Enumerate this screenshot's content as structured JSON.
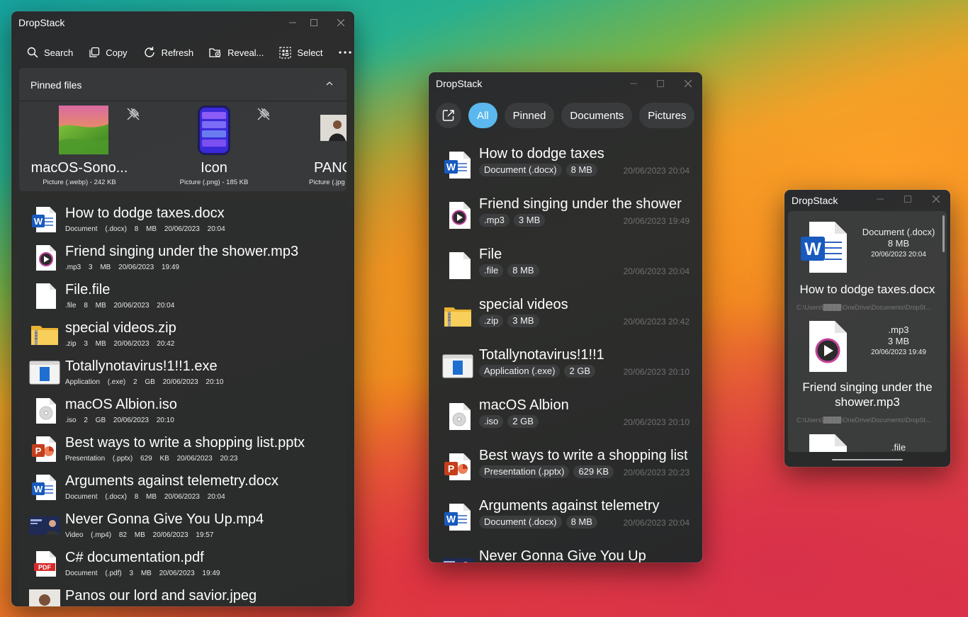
{
  "colors": {
    "accent": "#5bb8ee",
    "window_bg": "#2b2c2d",
    "chip_bg": "#3a3b3c"
  },
  "window_controls": [
    "minimize-icon",
    "maximize-icon",
    "close-icon"
  ],
  "w1": {
    "title": "DropStack",
    "toolbar": [
      {
        "label": "Search",
        "icon": "search-icon"
      },
      {
        "label": "Copy",
        "icon": "copy-icon"
      },
      {
        "label": "Refresh",
        "icon": "refresh-icon"
      },
      {
        "label": "Reveal...",
        "icon": "reveal-folder-icon"
      },
      {
        "label": "Select",
        "icon": "select-icon"
      }
    ],
    "more_icon": "more-icon",
    "pinned": {
      "title": "Pinned files",
      "items": [
        {
          "name": "macOS-Sono...",
          "meta": "Picture (.webp)  -  242   KB",
          "icon": "image-thumbnail"
        },
        {
          "name": "Icon",
          "meta": "Picture (.png)  -  185   KB",
          "icon": "phone-icon"
        },
        {
          "name": "PANO",
          "meta": "Picture (.jpg",
          "icon": "photo-thumbnail"
        }
      ]
    },
    "files": [
      {
        "name": "How to dodge taxes.docx",
        "meta": "Document (.docx) 8 MB 20/06/2023 20:04",
        "icon": "word-icon"
      },
      {
        "name": "Friend singing under the shower.mp3",
        "meta": ".mp3 3 MB 20/06/2023 19:49",
        "icon": "audio-icon"
      },
      {
        "name": "File.file",
        "meta": ".file 8 MB 20/06/2023 20:04",
        "icon": "blank-file-icon"
      },
      {
        "name": "special videos.zip",
        "meta": ".zip 3 MB 20/06/2023 20:42",
        "icon": "zip-folder-icon"
      },
      {
        "name": "Totallynotavirus!1!!1.exe",
        "meta": "Application (.exe) 2 GB 20/06/2023 20:10",
        "icon": "exe-icon"
      },
      {
        "name": "macOS Albion.iso",
        "meta": ".iso 2 GB 20/06/2023 20:10",
        "icon": "disc-icon"
      },
      {
        "name": "Best ways to write a shopping list.pptx",
        "meta": "Presentation (.pptx) 629 KB 20/06/2023 20:23",
        "icon": "powerpoint-icon"
      },
      {
        "name": "Arguments against telemetry.docx",
        "meta": "Document (.docx) 8 MB 20/06/2023 20:04",
        "icon": "word-icon"
      },
      {
        "name": "Never Gonna Give You Up.mp4",
        "meta": "Video (.mp4) 82 MB 20/06/2023 19:57",
        "icon": "video-thumbnail"
      },
      {
        "name": "C# documentation.pdf",
        "meta": "Document (.pdf) 3 MB 20/06/2023 19:49",
        "icon": "pdf-icon"
      },
      {
        "name": "Panos our lord and savior.jpeg",
        "meta": "",
        "icon": "photo-thumbnail"
      }
    ]
  },
  "w2": {
    "title": "DropStack",
    "open_icon": "open-external-icon",
    "filters": [
      "All",
      "Pinned",
      "Documents",
      "Pictures"
    ],
    "active_filter": "All",
    "files": [
      {
        "name": "How to dodge taxes",
        "tags": [
          "Document (.docx)",
          "8 MB"
        ],
        "date": "20/06/2023 20:04",
        "icon": "word-icon"
      },
      {
        "name": "Friend singing under the shower",
        "tags": [
          ".mp3",
          "3 MB"
        ],
        "date": "20/06/2023 19:49",
        "icon": "audio-icon"
      },
      {
        "name": "File",
        "tags": [
          ".file",
          "8 MB"
        ],
        "date": "20/06/2023 20:04",
        "icon": "blank-file-icon"
      },
      {
        "name": "special videos",
        "tags": [
          ".zip",
          "3 MB"
        ],
        "date": "20/06/2023 20:42",
        "icon": "zip-folder-icon"
      },
      {
        "name": "Totallynotavirus!1!!1",
        "tags": [
          "Application (.exe)",
          "2 GB"
        ],
        "date": "20/06/2023 20:10",
        "icon": "exe-icon"
      },
      {
        "name": "macOS Albion",
        "tags": [
          ".iso",
          "2 GB"
        ],
        "date": "20/06/2023 20:10",
        "icon": "disc-icon"
      },
      {
        "name": "Best ways to write a shopping list",
        "tags": [
          "Presentation (.pptx)",
          "629 KB"
        ],
        "date": "20/06/2023 20:23",
        "icon": "powerpoint-icon"
      },
      {
        "name": "Arguments against telemetry",
        "tags": [
          "Document (.docx)",
          "8 MB"
        ],
        "date": "20/06/2023 20:04",
        "icon": "word-icon"
      },
      {
        "name": "Never Gonna Give You Up",
        "tags": [],
        "date": "",
        "icon": "video-thumbnail"
      }
    ]
  },
  "w3": {
    "title": "DropStack",
    "files": [
      {
        "type": "Document (.docx)",
        "size": "8   MB",
        "date": "20/06/2023 20:04",
        "name": "How to dodge taxes.docx",
        "path": "C:\\Users\\████\\OneDrive\\Documents\\DropSt...",
        "icon": "word-icon"
      },
      {
        "type": ".mp3",
        "size": "3   MB",
        "date": "20/06/2023 19:49",
        "name": "Friend singing under the shower.mp3",
        "path": "C:\\Users\\████\\OneDrive\\Documents\\DropSt...",
        "icon": "audio-icon"
      },
      {
        "type": ".file",
        "size": "",
        "date": "",
        "name": "",
        "path": "",
        "icon": "blank-file-icon"
      }
    ]
  }
}
